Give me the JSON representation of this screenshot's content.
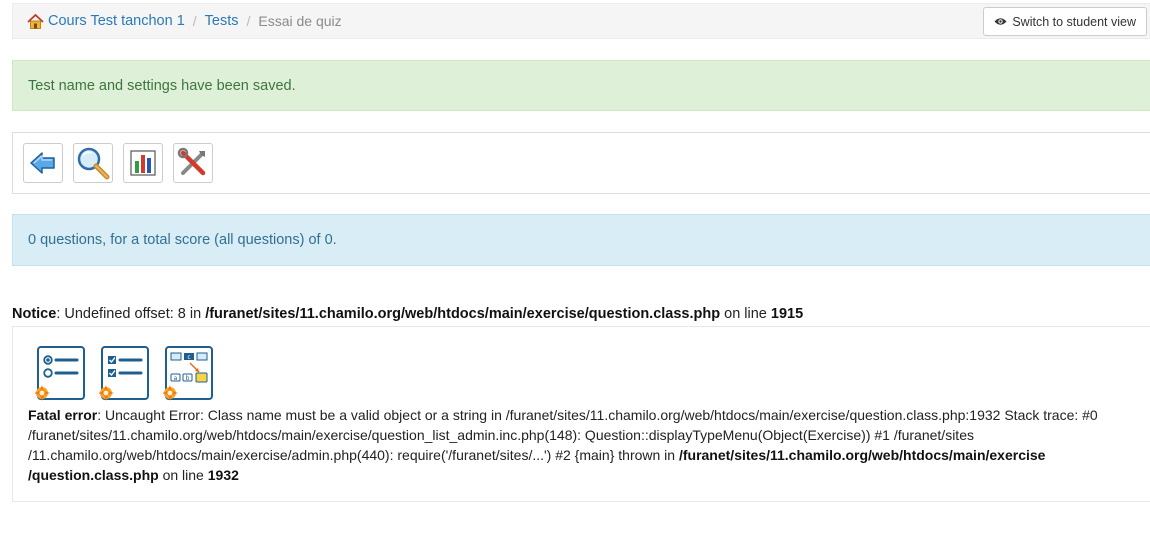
{
  "breadcrumb": {
    "items": [
      "Cours Test tanchon 1",
      "Tests"
    ],
    "current": "Essai de quiz",
    "separator": "/"
  },
  "header": {
    "student_view_label": "Switch to student view"
  },
  "alerts": {
    "success": "Test name and settings have been saved.",
    "info": "0 questions, for a total score (all questions) of 0."
  },
  "toolbar": {
    "buttons": [
      "back-icon",
      "preview-icon",
      "statistics-icon",
      "settings-icon"
    ]
  },
  "notice": {
    "label": "Notice",
    "message": ": Undefined offset: 8 in ",
    "file": "/furanet/sites/11.chamilo.org/web/htdocs/main/exercise/question.class.php",
    "on_line": " on line ",
    "line": "1915"
  },
  "question_types": [
    "unique-answer-icon",
    "multiple-answer-icon",
    "matching-icon"
  ],
  "fatal": {
    "label": "Fatal error",
    "message": ": Uncaught Error: Class name must be a valid object or a string in /furanet/sites/11.chamilo.org/web/htdocs/main/exercise/question.class.php:1932 Stack trace: #0 /furanet/sites/11.chamilo.org/web/htdocs/main/exercise/question_list_admin.inc.php(148): Question::displayTypeMenu(Object(Exercise)) #1 /furanet/sites /11.chamilo.org/web/htdocs/main/exercise/admin.php(440): require('/furanet/sites/...') #2 {main} thrown in ",
    "file": "/furanet/sites/11.chamilo.org/web/htdocs/main/exercise /question.class.php",
    "on_line": " on line ",
    "line": "1932"
  },
  "colors": {
    "link": "#2a7ab8",
    "success_bg": "#dff0d8",
    "success_text": "#3c763d",
    "info_bg": "#d9edf7",
    "info_text": "#31708f"
  }
}
